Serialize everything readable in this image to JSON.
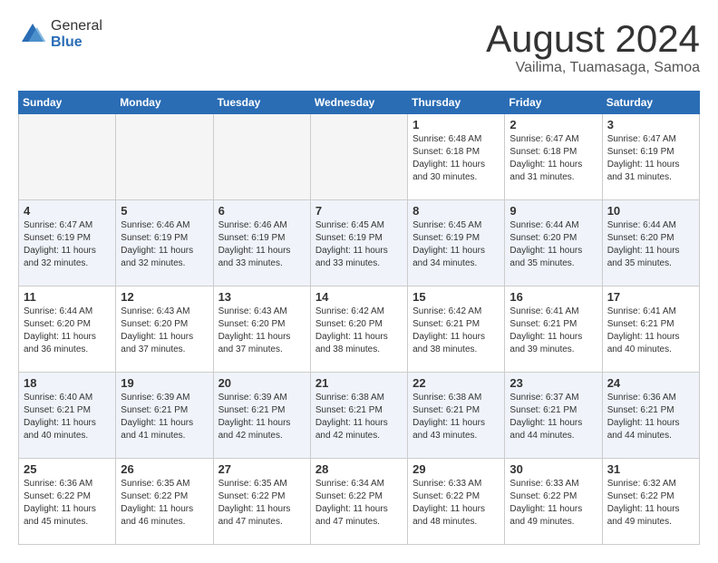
{
  "header": {
    "logo_general": "General",
    "logo_blue": "Blue",
    "month_year": "August 2024",
    "location": "Vailima, Tuamasaga, Samoa"
  },
  "days_of_week": [
    "Sunday",
    "Monday",
    "Tuesday",
    "Wednesday",
    "Thursday",
    "Friday",
    "Saturday"
  ],
  "weeks": [
    [
      {
        "day": "",
        "info": ""
      },
      {
        "day": "",
        "info": ""
      },
      {
        "day": "",
        "info": ""
      },
      {
        "day": "",
        "info": ""
      },
      {
        "day": "1",
        "info": "Sunrise: 6:48 AM\nSunset: 6:18 PM\nDaylight: 11 hours\nand 30 minutes."
      },
      {
        "day": "2",
        "info": "Sunrise: 6:47 AM\nSunset: 6:18 PM\nDaylight: 11 hours\nand 31 minutes."
      },
      {
        "day": "3",
        "info": "Sunrise: 6:47 AM\nSunset: 6:19 PM\nDaylight: 11 hours\nand 31 minutes."
      }
    ],
    [
      {
        "day": "4",
        "info": "Sunrise: 6:47 AM\nSunset: 6:19 PM\nDaylight: 11 hours\nand 32 minutes."
      },
      {
        "day": "5",
        "info": "Sunrise: 6:46 AM\nSunset: 6:19 PM\nDaylight: 11 hours\nand 32 minutes."
      },
      {
        "day": "6",
        "info": "Sunrise: 6:46 AM\nSunset: 6:19 PM\nDaylight: 11 hours\nand 33 minutes."
      },
      {
        "day": "7",
        "info": "Sunrise: 6:45 AM\nSunset: 6:19 PM\nDaylight: 11 hours\nand 33 minutes."
      },
      {
        "day": "8",
        "info": "Sunrise: 6:45 AM\nSunset: 6:19 PM\nDaylight: 11 hours\nand 34 minutes."
      },
      {
        "day": "9",
        "info": "Sunrise: 6:44 AM\nSunset: 6:20 PM\nDaylight: 11 hours\nand 35 minutes."
      },
      {
        "day": "10",
        "info": "Sunrise: 6:44 AM\nSunset: 6:20 PM\nDaylight: 11 hours\nand 35 minutes."
      }
    ],
    [
      {
        "day": "11",
        "info": "Sunrise: 6:44 AM\nSunset: 6:20 PM\nDaylight: 11 hours\nand 36 minutes."
      },
      {
        "day": "12",
        "info": "Sunrise: 6:43 AM\nSunset: 6:20 PM\nDaylight: 11 hours\nand 37 minutes."
      },
      {
        "day": "13",
        "info": "Sunrise: 6:43 AM\nSunset: 6:20 PM\nDaylight: 11 hours\nand 37 minutes."
      },
      {
        "day": "14",
        "info": "Sunrise: 6:42 AM\nSunset: 6:20 PM\nDaylight: 11 hours\nand 38 minutes."
      },
      {
        "day": "15",
        "info": "Sunrise: 6:42 AM\nSunset: 6:21 PM\nDaylight: 11 hours\nand 38 minutes."
      },
      {
        "day": "16",
        "info": "Sunrise: 6:41 AM\nSunset: 6:21 PM\nDaylight: 11 hours\nand 39 minutes."
      },
      {
        "day": "17",
        "info": "Sunrise: 6:41 AM\nSunset: 6:21 PM\nDaylight: 11 hours\nand 40 minutes."
      }
    ],
    [
      {
        "day": "18",
        "info": "Sunrise: 6:40 AM\nSunset: 6:21 PM\nDaylight: 11 hours\nand 40 minutes."
      },
      {
        "day": "19",
        "info": "Sunrise: 6:39 AM\nSunset: 6:21 PM\nDaylight: 11 hours\nand 41 minutes."
      },
      {
        "day": "20",
        "info": "Sunrise: 6:39 AM\nSunset: 6:21 PM\nDaylight: 11 hours\nand 42 minutes."
      },
      {
        "day": "21",
        "info": "Sunrise: 6:38 AM\nSunset: 6:21 PM\nDaylight: 11 hours\nand 42 minutes."
      },
      {
        "day": "22",
        "info": "Sunrise: 6:38 AM\nSunset: 6:21 PM\nDaylight: 11 hours\nand 43 minutes."
      },
      {
        "day": "23",
        "info": "Sunrise: 6:37 AM\nSunset: 6:21 PM\nDaylight: 11 hours\nand 44 minutes."
      },
      {
        "day": "24",
        "info": "Sunrise: 6:36 AM\nSunset: 6:21 PM\nDaylight: 11 hours\nand 44 minutes."
      }
    ],
    [
      {
        "day": "25",
        "info": "Sunrise: 6:36 AM\nSunset: 6:22 PM\nDaylight: 11 hours\nand 45 minutes."
      },
      {
        "day": "26",
        "info": "Sunrise: 6:35 AM\nSunset: 6:22 PM\nDaylight: 11 hours\nand 46 minutes."
      },
      {
        "day": "27",
        "info": "Sunrise: 6:35 AM\nSunset: 6:22 PM\nDaylight: 11 hours\nand 47 minutes."
      },
      {
        "day": "28",
        "info": "Sunrise: 6:34 AM\nSunset: 6:22 PM\nDaylight: 11 hours\nand 47 minutes."
      },
      {
        "day": "29",
        "info": "Sunrise: 6:33 AM\nSunset: 6:22 PM\nDaylight: 11 hours\nand 48 minutes."
      },
      {
        "day": "30",
        "info": "Sunrise: 6:33 AM\nSunset: 6:22 PM\nDaylight: 11 hours\nand 49 minutes."
      },
      {
        "day": "31",
        "info": "Sunrise: 6:32 AM\nSunset: 6:22 PM\nDaylight: 11 hours\nand 49 minutes."
      }
    ]
  ]
}
